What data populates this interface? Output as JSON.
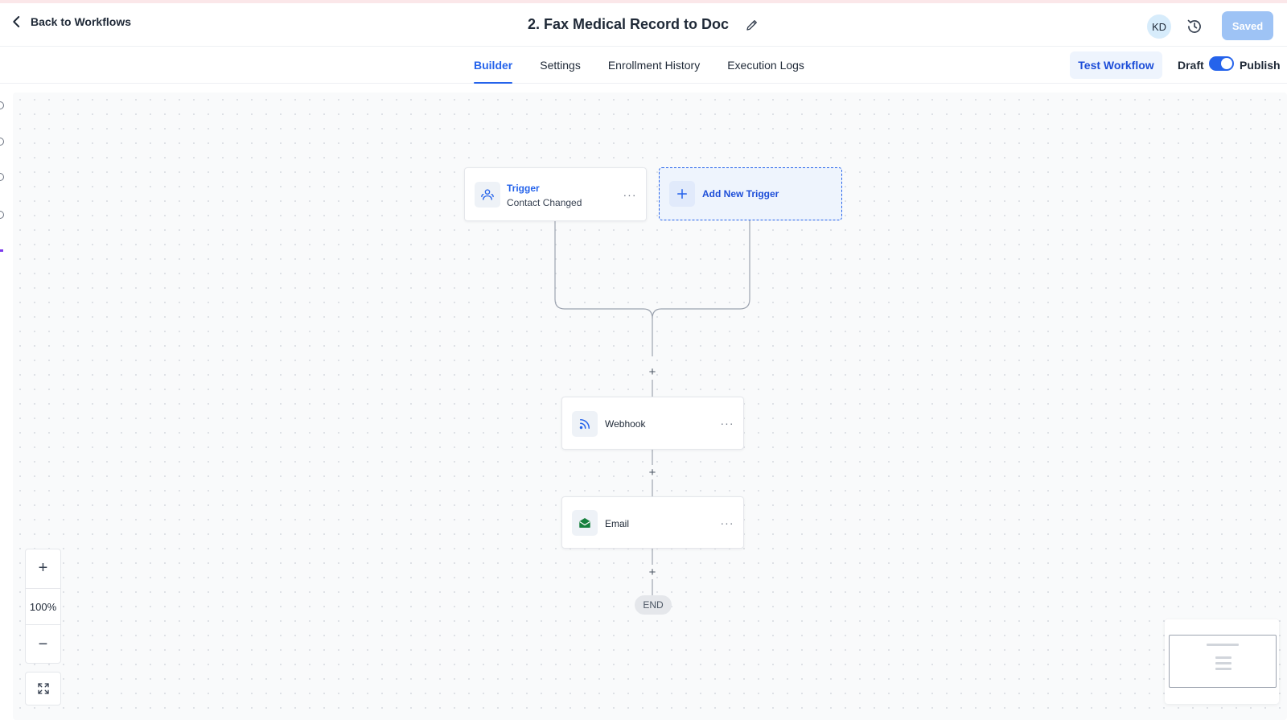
{
  "header": {
    "back_label": "Back to Workflows",
    "title": "2. Fax Medical Record to Doc",
    "avatar_initials": "KD",
    "saved_label": "Saved"
  },
  "tabs": [
    {
      "label": "Builder",
      "active": true
    },
    {
      "label": "Settings",
      "active": false
    },
    {
      "label": "Enrollment History",
      "active": false
    },
    {
      "label": "Execution Logs",
      "active": false
    }
  ],
  "toolbar": {
    "test_label": "Test Workflow",
    "draft_label": "Draft",
    "publish_label": "Publish",
    "publish_enabled": true
  },
  "workflow": {
    "trigger": {
      "title": "Trigger",
      "subtitle": "Contact Changed",
      "icon": "user-group-icon"
    },
    "add_trigger_label": "Add New Trigger",
    "steps": [
      {
        "title": "Webhook",
        "icon": "webhook-icon"
      },
      {
        "title": "Email",
        "icon": "email-icon"
      }
    ],
    "end_label": "END",
    "add_step_symbol": "+"
  },
  "zoom": {
    "in_symbol": "+",
    "level": "100%",
    "out_symbol": "−"
  },
  "colors": {
    "accent": "#2563eb",
    "saved_button": "#9ec3f5",
    "email_icon": "#15803d",
    "canvas": "#f9fafb"
  }
}
